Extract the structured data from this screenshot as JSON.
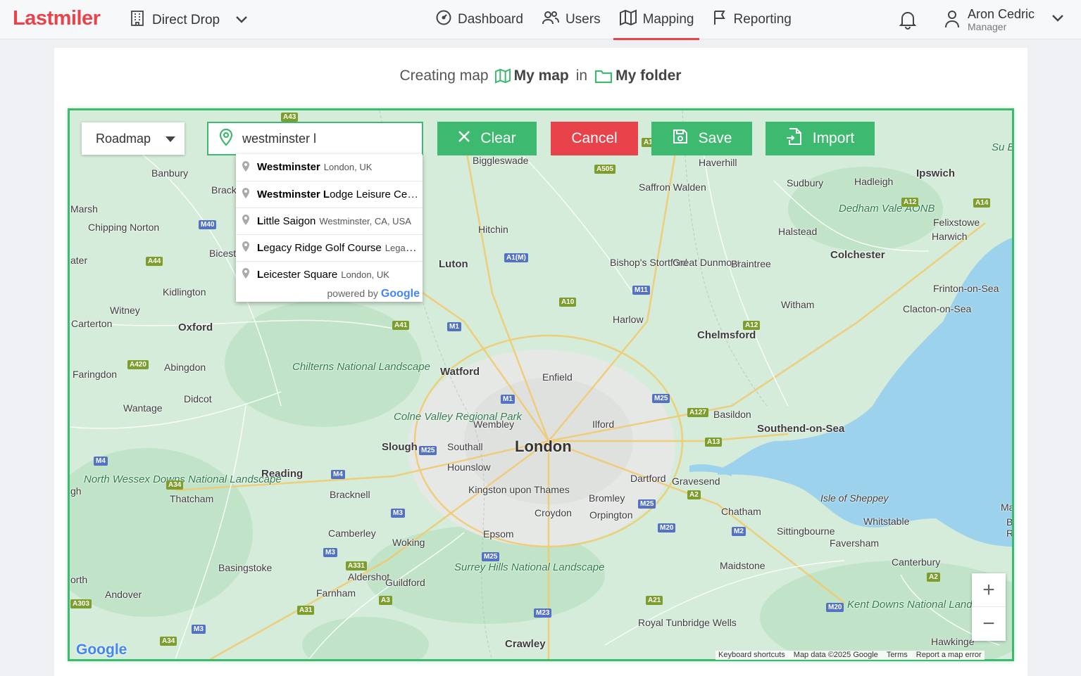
{
  "app": {
    "logo": "Lastmiler"
  },
  "org_selector": {
    "label": "Direct Drop"
  },
  "nav": {
    "items": [
      {
        "label": "Dashboard",
        "icon": "dashboard-icon"
      },
      {
        "label": "Users",
        "icon": "users-icon"
      },
      {
        "label": "Mapping",
        "icon": "map-icon",
        "active": true
      },
      {
        "label": "Reporting",
        "icon": "flag-icon"
      }
    ]
  },
  "user": {
    "name": "Aron Cedric",
    "role": "Manager"
  },
  "heading": {
    "prefix": "Creating map",
    "map_name": "My map",
    "in_word": "in",
    "folder_name": "My folder"
  },
  "map_controls": {
    "map_type": "Roadmap",
    "search_value": "westminster l",
    "clear_label": "Clear",
    "cancel_label": "Cancel",
    "save_label": "Save",
    "import_label": "Import",
    "zoom_in": "+",
    "zoom_out": "−"
  },
  "autocomplete": {
    "items": [
      {
        "main_bold": "Westminster",
        "main_rest": "",
        "secondary": "London, UK"
      },
      {
        "main_bold": "Westminster L",
        "main_rest": "odge Leisure Centre",
        "secondary": ""
      },
      {
        "main_bold": "L",
        "main_rest": "ittle Saigon",
        "secondary": "Westminster, CA, USA"
      },
      {
        "main_bold": "L",
        "main_rest": "egacy Ridge Golf Course",
        "secondary": "Legacy Ridge"
      },
      {
        "main_bold": "L",
        "main_rest": "eicester Square",
        "secondary": "London, UK"
      }
    ],
    "powered_by": "powered by",
    "google": "Google"
  },
  "map_labels": {
    "big": [
      "London"
    ],
    "towns": [
      "Oxford",
      "Watford",
      "Slough",
      "Reading",
      "Luton",
      "Chelmsford",
      "Colchester",
      "Southend-on-Sea",
      "Ipswich",
      "Crawley"
    ],
    "places": [
      "Banbury",
      "Brackley",
      "Marsh",
      "Chipping Norton",
      "Bicester",
      "ater",
      "Kidlington",
      "Witney",
      "Carterton",
      "Faringdon",
      "Abingdon",
      "Wantage",
      "Didcot",
      "Biggleswade",
      "Haverhill",
      "Sudbury",
      "Hadleigh",
      "Saffron Walden",
      "Hitchin",
      "Halstead",
      "Felixstowe",
      "Harwich",
      "Bishop's Stortford",
      "Great Dunmow",
      "Braintree",
      "Frinton-on-Sea",
      "Witham",
      "Clacton-on-Sea",
      "Harlow",
      "Enfield",
      "Wembley",
      "Ilford",
      "Basildon",
      "Southall",
      "Hounslow",
      "Kingston upon Thames",
      "Bracknell",
      "Croydon",
      "Bromley",
      "Orpington",
      "Dartford",
      "Gravesend",
      "Chatham",
      "Sittingbourne",
      "Whitstable",
      "Faversham",
      "Camberley",
      "Woking",
      "Epsom",
      "Thatcham",
      "Basingstoke",
      "Aldershot",
      "Guildford",
      "Farnham",
      "Maidstone",
      "Canterbury",
      "Hawkinge",
      "Royal Tunbridge Wells",
      "Andover",
      "orth",
      "gh",
      "Marg",
      "Bro",
      "Rar",
      "Isle of Sheppey"
    ],
    "parks": [
      "Chilterns National Landscape",
      "Colne Valley Regional Park",
      "Dedham Vale AONB",
      "North Wessex Downs National Landscape",
      "Surrey Hills National Landscape",
      "Kent Downs National Landscape",
      "Su Ess & Na"
    ],
    "roads_a": [
      "A43",
      "A505",
      "A44",
      "A41",
      "A10",
      "A12",
      "A14",
      "A420",
      "A34",
      "A127",
      "A13",
      "A2",
      "A331",
      "A3",
      "A31",
      "A303",
      "A21",
      "A1"
    ],
    "roads_m": [
      "M40",
      "M1",
      "A1(M)",
      "M11",
      "M25",
      "M4",
      "M3",
      "M23",
      "M20",
      "M2"
    ]
  },
  "map_footer": {
    "google_watermark": "Google",
    "keyboard_shortcuts": "Keyboard shortcuts",
    "map_data": "Map data ©2025 Google",
    "terms": "Terms",
    "report": "Report a map error"
  },
  "colors": {
    "brand_red": "#e8424b",
    "accent_green": "#3dba6f",
    "water": "#9cd2ec",
    "land": "#d4ecd9"
  }
}
